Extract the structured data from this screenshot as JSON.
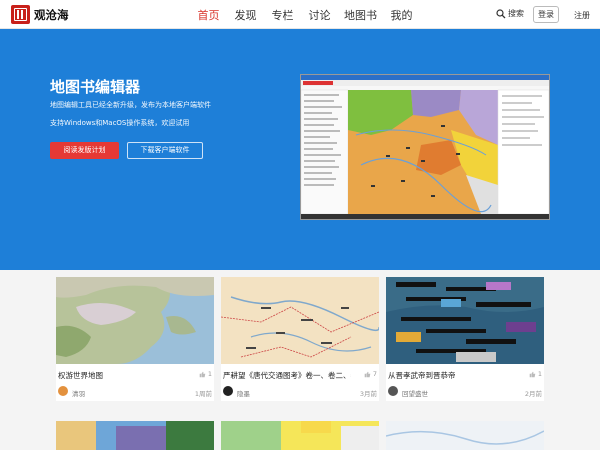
{
  "header": {
    "site_name": "观沧海",
    "nav": [
      "首页",
      "发现",
      "专栏",
      "讨论",
      "地图书",
      "我的"
    ],
    "active_nav": "首页",
    "search_label": "搜索",
    "login_label": "登录",
    "register_label": "注册"
  },
  "hero": {
    "title": "地图书编辑器",
    "subtitle1": "地图编辑工具已经全新升级，发布为本地客户端软件",
    "subtitle2": "支持Windows和MacOS操作系统，欢迎试用",
    "primary_button": "阅读发版计划",
    "secondary_button": "下载客户端软件"
  },
  "cards": [
    {
      "title": "权游世界地图",
      "likes": "1",
      "author": "清羽",
      "time": "1周前"
    },
    {
      "title": "严耕望《唐代交通图考》卷一、卷二、卷三...",
      "likes": "7",
      "author": "隐墨",
      "time": "3月前"
    },
    {
      "title": "从晋孝武帝到晋恭帝",
      "likes": "1",
      "author": "回望盛世",
      "time": "2月前"
    }
  ],
  "colors": {
    "accent": "#d8342a",
    "hero_bg": "#1e7fd8",
    "primary_button": "#e53935"
  },
  "icons": {
    "search": "search-icon",
    "like": "thumbs-up-icon",
    "logo": "logo-icon"
  }
}
